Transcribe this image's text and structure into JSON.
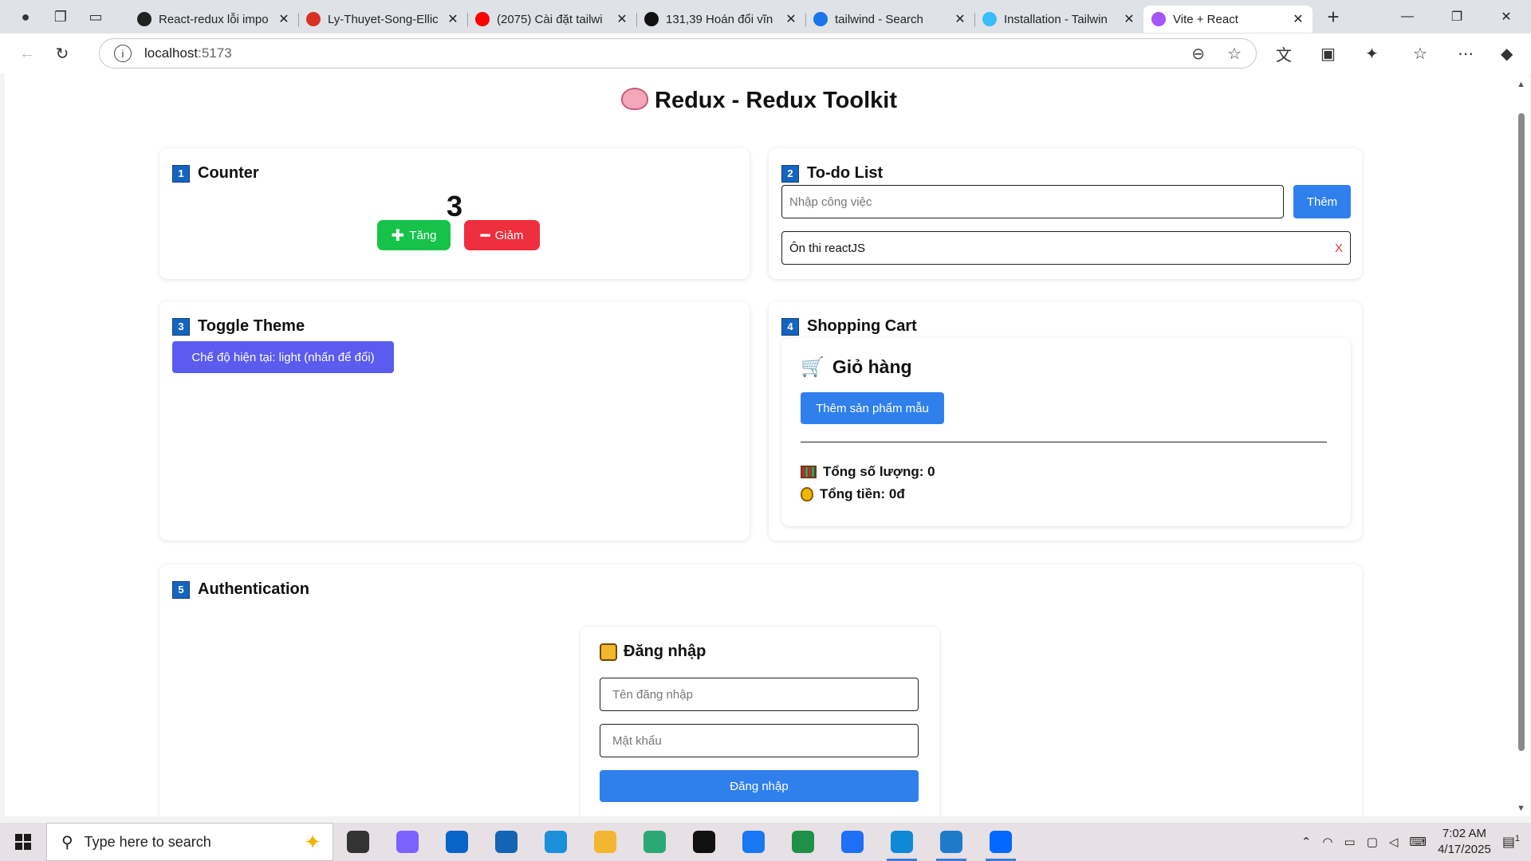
{
  "browser": {
    "tabs": [
      {
        "title": "React-redux lỗi impo",
        "favicon": "chatgpt-icon",
        "color": "#222222"
      },
      {
        "title": "Ly-Thuyet-Song-Ellic",
        "favicon": "pdf-icon",
        "color": "#d93025"
      },
      {
        "title": "(2075) Cài đặt tailwi",
        "favicon": "youtube-icon",
        "color": "#ff0000"
      },
      {
        "title": "131,39 Hoán đổi vĩn",
        "favicon": "okx-icon",
        "color": "#111111"
      },
      {
        "title": "tailwind - Search",
        "favicon": "bing-search-icon",
        "color": "#1a73e8"
      },
      {
        "title": "Installation - Tailwin",
        "favicon": "tailwind-icon",
        "color": "#38bdf8"
      },
      {
        "title": "Vite + React",
        "favicon": "vite-icon",
        "color": "#a855f7",
        "active": true
      }
    ],
    "url_host": "localhost",
    "url_port": ":5173"
  },
  "page": {
    "title": "Redux - Redux Toolkit",
    "counter": {
      "number": "1",
      "heading": "Counter",
      "value": "3",
      "increase_label": "Tăng",
      "decrease_label": "Giảm"
    },
    "todo": {
      "number": "2",
      "heading": "To-do List",
      "input_placeholder": "Nhập công việc",
      "add_label": "Thêm",
      "items": [
        {
          "text": "Ôn thi reactJS",
          "remove": "X"
        }
      ]
    },
    "theme": {
      "number": "3",
      "heading": "Toggle Theme",
      "button_label": "Chế độ hiện tại: light (nhấn để đổi)"
    },
    "cart": {
      "number": "4",
      "heading": "Shopping Cart",
      "title": "Giỏ hàng",
      "add_sample_label": "Thêm sản phẩm mẫu",
      "total_qty": "Tổng số lượng: 0",
      "total_price": "Tổng tiền: 0đ"
    },
    "auth": {
      "number": "5",
      "heading": "Authentication",
      "login_title": "Đăng nhập",
      "username_placeholder": "Tên đăng nhập",
      "password_placeholder": "Mật khẩu",
      "submit_label": "Đăng nhập"
    }
  },
  "taskbar": {
    "search_placeholder": "Type here to search",
    "time": "7:02 AM",
    "date": "4/17/2025",
    "notification_count": "1",
    "apps": [
      {
        "name": "task-view-icon",
        "color": "#333333"
      },
      {
        "name": "copilot-icon",
        "color": "#7b61ff"
      },
      {
        "name": "outlook-icon",
        "color": "#0a64c8"
      },
      {
        "name": "microsoft-store-icon",
        "color": "#1464b4"
      },
      {
        "name": "remote-desktop-icon",
        "color": "#1b8fd8"
      },
      {
        "name": "file-explorer-icon",
        "color": "#f2b632"
      },
      {
        "name": "snipping-tool-icon",
        "color": "#2aa876"
      },
      {
        "name": "tiktok-icon",
        "color": "#111111"
      },
      {
        "name": "facebook-icon",
        "color": "#1877f2"
      },
      {
        "name": "hs-app-icon",
        "color": "#1f8f4a"
      },
      {
        "name": "messenger-icon",
        "color": "#1e6ff5"
      },
      {
        "name": "edge-icon",
        "color": "#0c8ad6",
        "active": true
      },
      {
        "name": "vscode-icon",
        "color": "#1f7acc",
        "active": true
      },
      {
        "name": "zalo-icon",
        "color": "#0068ff",
        "active": true
      }
    ]
  }
}
